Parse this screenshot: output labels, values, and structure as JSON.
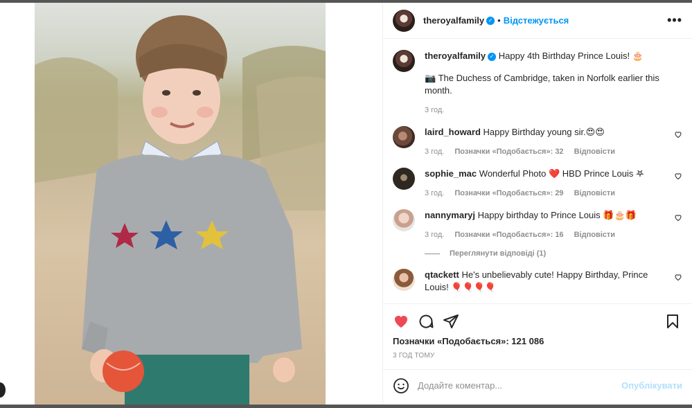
{
  "header": {
    "username": "theroyalfamily",
    "separator": "•",
    "follow_status": "Відстежується",
    "more": "•••"
  },
  "caption": {
    "username": "theroyalfamily",
    "text": "Happy 4th Birthday Prince Louis! 🎂",
    "line2": "📷 The Duchess of Cambridge, taken in Norfolk earlier this month.",
    "time": "3 год."
  },
  "comments": [
    {
      "username": "laird_howard",
      "text": "Happy Birthday young sir.😍😍",
      "time": "3 год.",
      "likes": "Позначки «Подобається»: 32",
      "reply": "Відповісти"
    },
    {
      "username": "sophie_mac",
      "text": "Wonderful Photo ❤️ HBD Prince Louis 𖤐",
      "time": "3 год.",
      "likes": "Позначки «Подобається»: 29",
      "reply": "Відповісти"
    },
    {
      "username": "nannymaryj",
      "text": "Happy birthday to Prince Louis 🎁🎂🎁",
      "time": "3 год.",
      "likes": "Позначки «Подобається»: 16",
      "reply": "Відповісти",
      "view_replies": "Переглянути відповіді (1)"
    },
    {
      "username": "qtackett",
      "text": "He's unbelievably cute! Happy Birthday, Prince Louis! 🎈🎈🎈🎈"
    }
  ],
  "likes_count": "Позначки «Подобається»: 121 086",
  "time_ago": "3 ГОД ТОМУ",
  "comment_box": {
    "placeholder": "Додайте коментар...",
    "post_label": "Опублікувати"
  },
  "colors": {
    "accent": "#0095f6",
    "like_red": "#ed4956",
    "post_disabled": "#b2dffc"
  },
  "icons": [
    "heart-icon",
    "comment-icon",
    "share-icon",
    "bookmark-icon",
    "emoji-icon",
    "more-icon",
    "verified-icon"
  ]
}
